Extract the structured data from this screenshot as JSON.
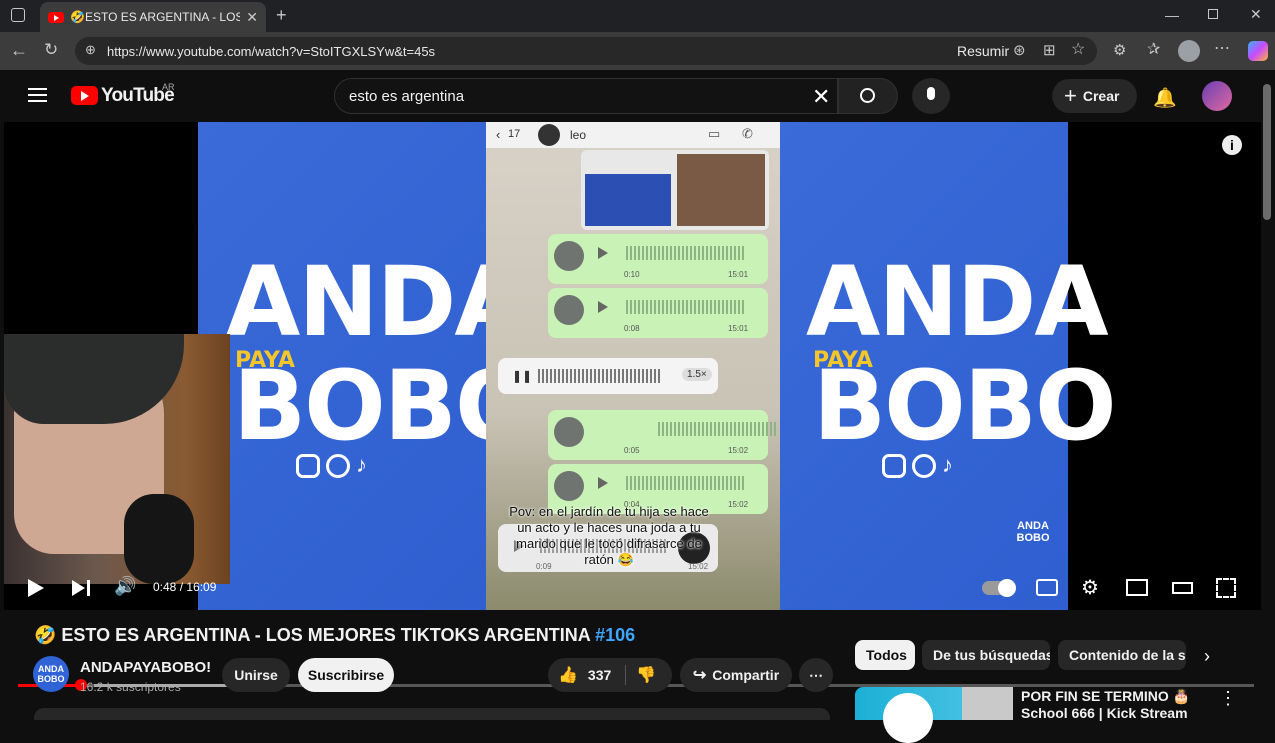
{
  "browser": {
    "tab_title": "🤣ESTO ES ARGENTINA - LOS M",
    "url": "https://www.youtube.com/watch?v=StoITGXLSYw&t=45s",
    "summarize_label": "Resumir"
  },
  "youtube": {
    "logo_text": "YouTube",
    "country_code": "AR",
    "search_value": "esto es argentina",
    "create_label": "Crear"
  },
  "video": {
    "time_display": "0:48 / 16:09",
    "progress_fraction": 0.05,
    "overlay": {
      "chat_back_count": "17",
      "chat_contact": "leo",
      "left_word1": "ANDA",
      "left_word2": "PAYA",
      "left_word3": "BOBO",
      "caption": "Pov: en el jardín de tu hija se hace un acto y le haces una joda a tu marido que le tocó difrasarce de ratón 😂",
      "speed_badge": "1.5×",
      "corner_logo": "ANDA BOBO",
      "voice_msgs": [
        {
          "duration": "0:10",
          "time": "15:01"
        },
        {
          "duration": "0:08",
          "time": "15:01"
        },
        {
          "duration": "0:05",
          "time": "15:02"
        },
        {
          "duration": "0:04",
          "time": "15:02"
        },
        {
          "duration": "0:09",
          "time": "15:02"
        }
      ]
    }
  },
  "meta": {
    "title_main": "🤣 ESTO ES ARGENTINA - LOS MEJORES TIKTOKS ARGENTINA ",
    "title_hash": "#106",
    "channel_name": "ANDAPAYABOBO!",
    "channel_avatar_text": "ANDA BOBO",
    "subscribers": "16.2 k suscriptores",
    "join_label": "Unirse",
    "subscribe_label": "Suscribirse",
    "likes": "337",
    "share_label": "Compartir"
  },
  "sidebar": {
    "chips": [
      "Todos",
      "De tus búsquedas",
      "Contenido de la se"
    ],
    "first_video_title": "POR FIN SE TERMINO 🎂 School 666 | Kick Stream"
  }
}
